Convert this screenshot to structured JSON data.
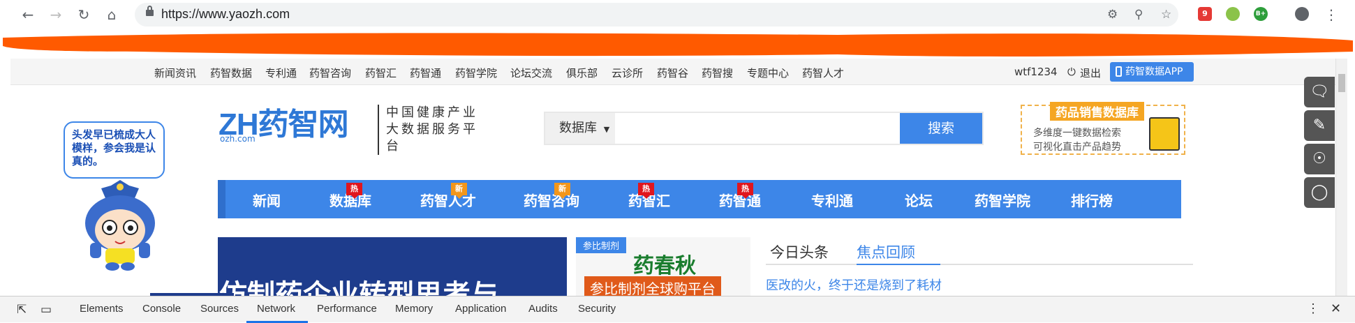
{
  "browser": {
    "url": "https://www.yaozh.com",
    "nav_icons": [
      "back-icon",
      "forward-icon",
      "reload-icon",
      "home-icon"
    ],
    "omnibox_icons": [
      "blocked-content-icon",
      "key-icon",
      "star-icon"
    ],
    "extensions": [
      {
        "name": "extension-red",
        "label": "9",
        "color": "#e53935"
      },
      {
        "name": "extension-yellow-green",
        "label": "",
        "color": "#8bc34a"
      },
      {
        "name": "extension-green-b",
        "label": "B+",
        "color": "#2e9e3b"
      }
    ]
  },
  "topnav": {
    "items": [
      "新闻资讯",
      "药智数据",
      "专利通",
      "药智咨询",
      "药智汇",
      "药智通",
      "药智学院",
      "论坛交流",
      "俱乐部",
      "云诊所",
      "药智谷",
      "药智搜",
      "专题中心",
      "药智人才"
    ],
    "username": "wtf1234",
    "logout": "退出",
    "app_button": "药智数据APP"
  },
  "mascot": {
    "speech": "头发早已梳成大人模样，参会我是认真的。"
  },
  "logo": {
    "main": "ZH药智网",
    "sub": "ozh.com",
    "slogan_line1": "中国健康产业",
    "slogan_line2": "大数据服务平台"
  },
  "search": {
    "select_label": "数据库",
    "placeholder": "",
    "button": "搜索"
  },
  "promo": {
    "title": "药品销售数据库",
    "line1": "多维度一键数据检索",
    "line2": "可视化直击产品趋势"
  },
  "mainnav": {
    "items": [
      {
        "label": "新闻",
        "tag": ""
      },
      {
        "label": "数据库",
        "tag": "热"
      },
      {
        "label": "药智人才",
        "tag": "新"
      },
      {
        "label": "药智咨询",
        "tag": "新"
      },
      {
        "label": "药智汇",
        "tag": "热"
      },
      {
        "label": "药智通",
        "tag": "热"
      },
      {
        "label": "专利通",
        "tag": ""
      },
      {
        "label": "论坛",
        "tag": ""
      },
      {
        "label": "药智学院",
        "tag": ""
      },
      {
        "label": "排行榜",
        "tag": ""
      }
    ]
  },
  "banners": {
    "left_text": "仿制药企业转型思考与",
    "right_tag": "参比制剂",
    "right_title": "药春秋",
    "right_sub": "参比制剂全球购平台"
  },
  "news": {
    "tabs": [
      "今日头条",
      "焦点回顾"
    ],
    "active_tab": "焦点回顾",
    "headline": "医改的火，终于还是烧到了耗材"
  },
  "sidetools": [
    "chat-icon",
    "edit-icon",
    "weibo-icon",
    "wechat-icon"
  ],
  "devtools": {
    "tabs": [
      "Elements",
      "Console",
      "Sources",
      "Network",
      "Performance",
      "Memory",
      "Application",
      "Audits",
      "Security"
    ],
    "active_tab": "Network"
  },
  "colors": {
    "accent": "#3d86e8",
    "hot_tag": "#e0161e",
    "new_tag": "#f2961b",
    "redaction": "#ff5a00"
  }
}
